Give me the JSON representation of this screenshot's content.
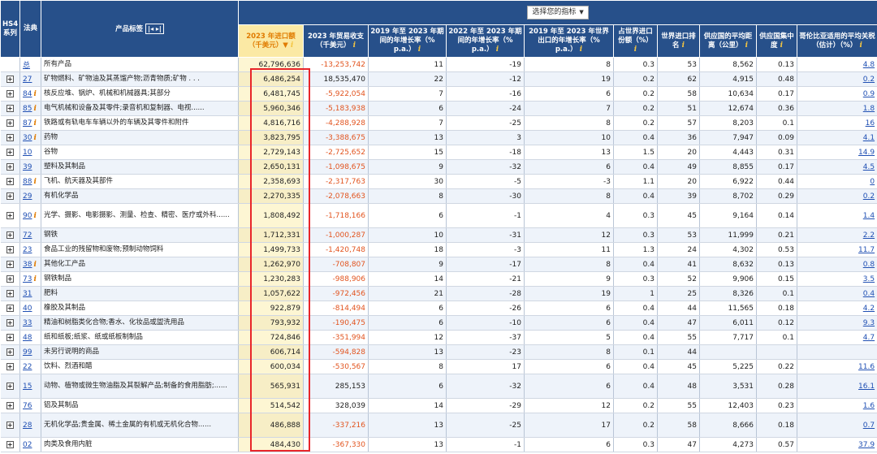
{
  "header": {
    "hs4": "HS4系列",
    "code": "法典",
    "product": "产品标签",
    "select_indicator": "选择您的指标",
    "cols": [
      "2023 年进口额（千美元）▼",
      "2023 年贸易收支（千美元）",
      "2019 年至 2023 年期间的年增长率（% p.a.）",
      "2022 年至 2023 年期间的年增长率（% p.a.）",
      "2019 年至 2023 年世界出口的年增长率（% p.a.）",
      "占世界进口份额（%）",
      "世界进口排名",
      "供应国的平均距离（公里）",
      "供应国集中度",
      "哥伦比亚适用的平均关税（估计）（%）"
    ]
  },
  "rows": [
    {
      "code": "总",
      "info": false,
      "product": "所有产品",
      "imp": "62,796,636",
      "bal": "-13,253,742",
      "g1923": "11",
      "g2223": "-19",
      "wg": "8",
      "share": "0.3",
      "rank": "53",
      "dist": "8,562",
      "conc": "0.13",
      "tariff": "4.8",
      "expander": false
    },
    {
      "code": "27",
      "info": false,
      "product": "矿物燃料、矿物油及其蒸馏产物;沥青物质;矿物 . . .",
      "imp": "6,486,254",
      "bal": "18,535,470",
      "g1923": "22",
      "g2223": "-12",
      "wg": "19",
      "share": "0.2",
      "rank": "62",
      "dist": "4,915",
      "conc": "0.48",
      "tariff": "0.2",
      "expander": true
    },
    {
      "code": "84",
      "info": true,
      "product": "核反应堆、锅炉、机械和机械器具;其部分",
      "imp": "6,481,745",
      "bal": "-5,922,054",
      "g1923": "7",
      "g2223": "-16",
      "wg": "6",
      "share": "0.2",
      "rank": "58",
      "dist": "10,634",
      "conc": "0.17",
      "tariff": "0.9",
      "expander": true
    },
    {
      "code": "85",
      "info": true,
      "product": "电气机械和设备及其零件;录音机和复制器、电视......",
      "imp": "5,960,346",
      "bal": "-5,183,938",
      "g1923": "6",
      "g2223": "-24",
      "wg": "7",
      "share": "0.2",
      "rank": "51",
      "dist": "12,674",
      "conc": "0.36",
      "tariff": "1.8",
      "expander": true
    },
    {
      "code": "87",
      "info": true,
      "product": "铁路或有轨电车车辆以外的车辆及其零件和附件",
      "imp": "4,816,716",
      "bal": "-4,288,928",
      "g1923": "7",
      "g2223": "-25",
      "wg": "8",
      "share": "0.2",
      "rank": "57",
      "dist": "8,203",
      "conc": "0.1",
      "tariff": "16",
      "expander": true
    },
    {
      "code": "30",
      "info": true,
      "product": "药物",
      "imp": "3,823,795",
      "bal": "-3,388,675",
      "g1923": "13",
      "g2223": "3",
      "wg": "10",
      "share": "0.4",
      "rank": "36",
      "dist": "7,947",
      "conc": "0.09",
      "tariff": "4.1",
      "expander": true
    },
    {
      "code": "10",
      "info": false,
      "product": "谷物",
      "imp": "2,729,143",
      "bal": "-2,725,652",
      "g1923": "15",
      "g2223": "-18",
      "wg": "13",
      "share": "1.5",
      "rank": "20",
      "dist": "4,443",
      "conc": "0.31",
      "tariff": "14.9",
      "expander": true
    },
    {
      "code": "39",
      "info": false,
      "product": "塑料及其制品",
      "imp": "2,650,131",
      "bal": "-1,098,675",
      "g1923": "9",
      "g2223": "-32",
      "wg": "6",
      "share": "0.4",
      "rank": "49",
      "dist": "8,855",
      "conc": "0.17",
      "tariff": "4.5",
      "expander": true
    },
    {
      "code": "88",
      "info": true,
      "product": "飞机、航天器及其部件",
      "imp": "2,358,693",
      "bal": "-2,317,763",
      "g1923": "30",
      "g2223": "-5",
      "wg": "-3",
      "share": "1.1",
      "rank": "20",
      "dist": "6,922",
      "conc": "0.44",
      "tariff": "0",
      "expander": true
    },
    {
      "code": "29",
      "info": false,
      "product": "有机化学品",
      "imp": "2,270,335",
      "bal": "-2,078,663",
      "g1923": "8",
      "g2223": "-30",
      "wg": "8",
      "share": "0.4",
      "rank": "39",
      "dist": "8,702",
      "conc": "0.29",
      "tariff": "0.2",
      "expander": true
    },
    {
      "code": "90",
      "info": true,
      "product": "光学、摄影、电影摄影、测量、检查、精密、医疗或外科......",
      "imp": "1,808,492",
      "bal": "-1,718,166",
      "g1923": "6",
      "g2223": "-1",
      "wg": "4",
      "share": "0.3",
      "rank": "45",
      "dist": "9,164",
      "conc": "0.14",
      "tariff": "1.4",
      "expander": true,
      "tall": true
    },
    {
      "code": "72",
      "info": false,
      "product": "钢铁",
      "imp": "1,712,331",
      "bal": "-1,000,287",
      "g1923": "10",
      "g2223": "-31",
      "wg": "12",
      "share": "0.3",
      "rank": "53",
      "dist": "11,999",
      "conc": "0.21",
      "tariff": "2.2",
      "expander": true
    },
    {
      "code": "23",
      "info": false,
      "product": "食品工业的残留物和废物;预制动物饲料",
      "imp": "1,499,733",
      "bal": "-1,420,748",
      "g1923": "18",
      "g2223": "-3",
      "wg": "11",
      "share": "1.3",
      "rank": "24",
      "dist": "4,302",
      "conc": "0.53",
      "tariff": "11.7",
      "expander": true
    },
    {
      "code": "38",
      "info": true,
      "product": "其他化工产品",
      "imp": "1,262,970",
      "bal": "-708,807",
      "g1923": "9",
      "g2223": "-17",
      "wg": "8",
      "share": "0.4",
      "rank": "41",
      "dist": "8,632",
      "conc": "0.13",
      "tariff": "0.8",
      "expander": true
    },
    {
      "code": "73",
      "info": true,
      "product": "钢铁制品",
      "imp": "1,230,283",
      "bal": "-988,906",
      "g1923": "14",
      "g2223": "-21",
      "wg": "9",
      "share": "0.3",
      "rank": "52",
      "dist": "9,906",
      "conc": "0.15",
      "tariff": "3.5",
      "expander": true
    },
    {
      "code": "31",
      "info": false,
      "product": "肥料",
      "imp": "1,057,622",
      "bal": "-972,456",
      "g1923": "21",
      "g2223": "-28",
      "wg": "19",
      "share": "1",
      "rank": "25",
      "dist": "8,326",
      "conc": "0.1",
      "tariff": "0.4",
      "expander": true
    },
    {
      "code": "40",
      "info": false,
      "product": "橡胶及其制品",
      "imp": "922,879",
      "bal": "-814,494",
      "g1923": "6",
      "g2223": "-26",
      "wg": "6",
      "share": "0.4",
      "rank": "44",
      "dist": "11,565",
      "conc": "0.18",
      "tariff": "4.2",
      "expander": true
    },
    {
      "code": "33",
      "info": false,
      "product": "精油和树脂类化合物;香水、化妆品或盥洗用品",
      "imp": "793,932",
      "bal": "-190,475",
      "g1923": "6",
      "g2223": "-10",
      "wg": "6",
      "share": "0.4",
      "rank": "47",
      "dist": "6,011",
      "conc": "0.12",
      "tariff": "9.3",
      "expander": true
    },
    {
      "code": "48",
      "info": false,
      "product": "纸和纸板;纸浆、纸或纸板制制品",
      "imp": "724,846",
      "bal": "-351,994",
      "g1923": "12",
      "g2223": "-37",
      "wg": "5",
      "share": "0.4",
      "rank": "55",
      "dist": "7,717",
      "conc": "0.1",
      "tariff": "4.7",
      "expander": true
    },
    {
      "code": "99",
      "info": false,
      "product": "未另行说明的商品",
      "imp": "606,714",
      "bal": "-594,828",
      "g1923": "13",
      "g2223": "-23",
      "wg": "8",
      "share": "0.1",
      "rank": "44",
      "dist": "",
      "conc": "",
      "tariff": "",
      "expander": true
    },
    {
      "code": "22",
      "info": false,
      "product": "饮料、烈酒和醋",
      "imp": "600,034",
      "bal": "-530,567",
      "g1923": "8",
      "g2223": "17",
      "wg": "6",
      "share": "0.4",
      "rank": "45",
      "dist": "5,225",
      "conc": "0.22",
      "tariff": "11.6",
      "expander": true
    },
    {
      "code": "15",
      "info": false,
      "product": "动物、植物或微生物油脂及其裂解产品;制备的食用脂肪;......",
      "imp": "565,931",
      "bal": "285,153",
      "g1923": "6",
      "g2223": "-32",
      "wg": "6",
      "share": "0.4",
      "rank": "48",
      "dist": "3,531",
      "conc": "0.28",
      "tariff": "16.1",
      "expander": true,
      "tall": true
    },
    {
      "code": "76",
      "info": false,
      "product": "铝及其制品",
      "imp": "514,542",
      "bal": "328,039",
      "g1923": "14",
      "g2223": "-29",
      "wg": "12",
      "share": "0.2",
      "rank": "55",
      "dist": "12,403",
      "conc": "0.23",
      "tariff": "1.6",
      "expander": true
    },
    {
      "code": "28",
      "info": false,
      "product": "无机化学品;贵金属、稀土金属的有机或无机化合物......",
      "imp": "486,888",
      "bal": "-337,216",
      "g1923": "13",
      "g2223": "-25",
      "wg": "17",
      "share": "0.2",
      "rank": "58",
      "dist": "8,666",
      "conc": "0.18",
      "tariff": "0.7",
      "expander": true,
      "tall": true
    },
    {
      "code": "02",
      "info": false,
      "product": "肉类及食用内脏",
      "imp": "484,430",
      "bal": "-367,330",
      "g1923": "13",
      "g2223": "-1",
      "wg": "6",
      "share": "0.3",
      "rank": "47",
      "dist": "4,273",
      "conc": "0.57",
      "tariff": "37.9",
      "expander": true
    }
  ]
}
